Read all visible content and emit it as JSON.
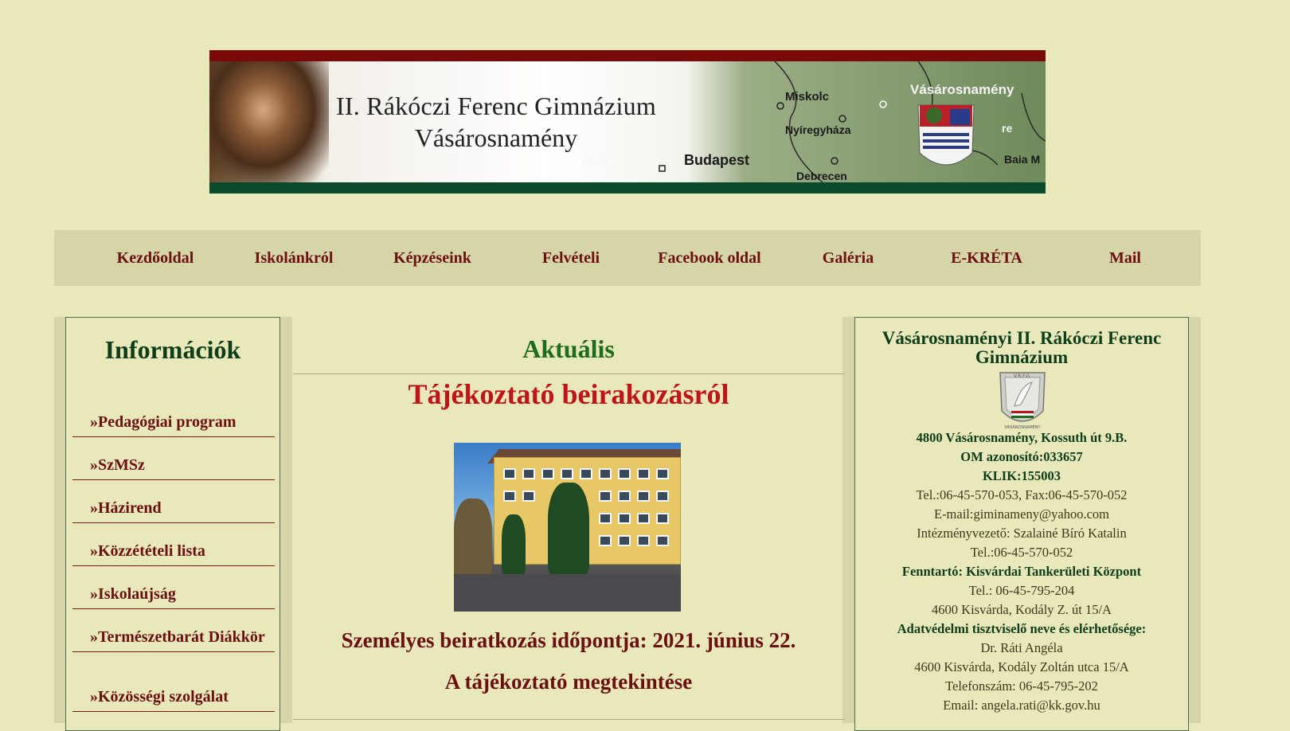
{
  "banner": {
    "title_line1": "II. Rákóczi Ferenc Gimnázium",
    "title_line2": "Vásárosnamény",
    "map_cities": {
      "miskolc": "Miskolc",
      "nyiregyhaza": "Nyíregyháza",
      "budapest": "Budapest",
      "debrecen": "Debrecen",
      "vasarosnameny": "Vásárosnamény",
      "baia": "Baia M",
      "gyor": "Győr",
      "re": "re"
    }
  },
  "nav": {
    "items": [
      {
        "label": "Kezdőoldal"
      },
      {
        "label": "Iskolánkról"
      },
      {
        "label": "Képzéseink"
      },
      {
        "label": "Felvételi"
      },
      {
        "label": "Facebook oldal"
      },
      {
        "label": "Galéria"
      },
      {
        "label": "E-KRÉTA"
      },
      {
        "label": "Mail"
      }
    ]
  },
  "sidebar": {
    "heading": "Információk",
    "items": [
      {
        "label": "»Pedagógiai program"
      },
      {
        "label": "»SzMSz"
      },
      {
        "label": "»Házirend"
      },
      {
        "label": "»Közzétételi lista"
      },
      {
        "label": "»Iskolaújság"
      },
      {
        "label": "»Természetbarát Diákkör"
      },
      {
        "label": "»Közösségi szolgálat"
      }
    ]
  },
  "main": {
    "section_title": "Aktuális",
    "article_title": "Tájékoztató beirakozásról",
    "date_line": "Személyes beiratkozás időpontja: 2021. június 22.",
    "link_line": "A tájékoztató megtekintése"
  },
  "contact": {
    "school_name_line1": "Vásárosnaményi II. Rákóczi Ferenc",
    "school_name_line2": "Gimnázium",
    "crest_text": "V.R.F.G.",
    "crest_bottom": "VÁSÁROSNAMÉNY",
    "address": "4800 Vásárosnamény, Kossuth út 9.B.",
    "om": "OM azonosító:033657",
    "klik": "KLIK:155003",
    "tel_fax": "Tel.:06-45-570-053, Fax:06-45-570-052",
    "email": "E-mail:giminameny@yahoo.com",
    "director": "Intézményvezető: Szalainé Bíró Katalin",
    "director_tel": "Tel.:06-45-570-052",
    "maintainer": "Fenntartó: Kisvárdai Tankerületi  Központ",
    "maintainer_tel": "Tel.: 06-45-795-204",
    "maintainer_addr": "4600 Kisvárda, Kodály Z. út 15/A",
    "dpo_title": "Adatvédelmi tisztviselő neve és elérhetősége:",
    "dpo_name": "Dr. Ráti Angéla",
    "dpo_addr": "4600 Kisvárda, Kodály Zoltán utca 15/A",
    "dpo_phone": "Telefonszám: 06-45-795-202",
    "dpo_email": "Email: angela.rati@kk.gov.hu"
  },
  "colors": {
    "page_bg": "#e9e8bb",
    "nav_bg": "#d6d5a8",
    "link": "#6b0f0f",
    "heading_green": "#0e3d1a",
    "accent_red": "#c0131a",
    "section_green": "#1d6b1d"
  }
}
